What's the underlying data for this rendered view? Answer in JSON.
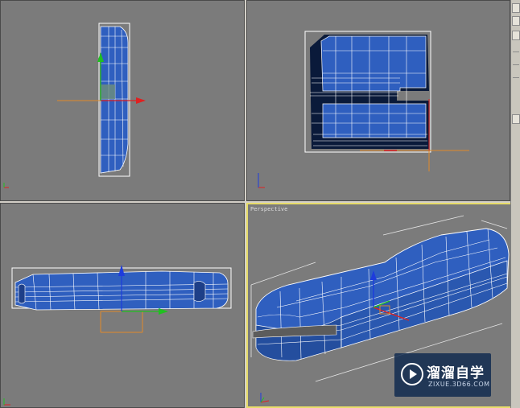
{
  "viewports": {
    "top_left": {
      "label": "",
      "active": false
    },
    "top_right": {
      "label": "",
      "active": false
    },
    "bottom_left": {
      "label": "",
      "active": false
    },
    "bottom_right": {
      "label": "Perspective",
      "active": true
    }
  },
  "colors": {
    "viewport_bg": "#7b7b7b",
    "mesh_blue": "#2f5fbf",
    "mesh_dark": "#0a1a3a",
    "wire": "#ffffff",
    "active_border": "#e8dd6a",
    "axis_x": "#e02020",
    "axis_y": "#20c020",
    "axis_z": "#1e3cdc",
    "gizmo_orange": "#e08a2a"
  },
  "watermark": {
    "title": "溜溜自学",
    "subtitle": "ZIXUE.3D66.COM"
  },
  "icons": [
    "axis-tripod-icon",
    "transform-gizmo-icon",
    "play-logo-icon"
  ]
}
